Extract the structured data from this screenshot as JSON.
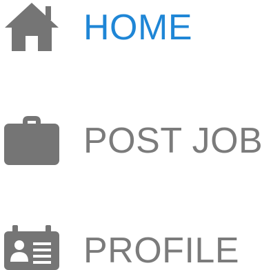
{
  "nav": {
    "items": [
      {
        "label": "HOME",
        "icon": "home-icon",
        "active": true
      },
      {
        "label": "POST JOB",
        "icon": "briefcase-icon",
        "active": false
      },
      {
        "label": "PROFILE",
        "icon": "id-badge-icon",
        "active": false
      }
    ]
  },
  "colors": {
    "active": "#1f86d6",
    "inactive": "#7b7b7b",
    "icon": "#757575",
    "background": "#ffffff"
  }
}
